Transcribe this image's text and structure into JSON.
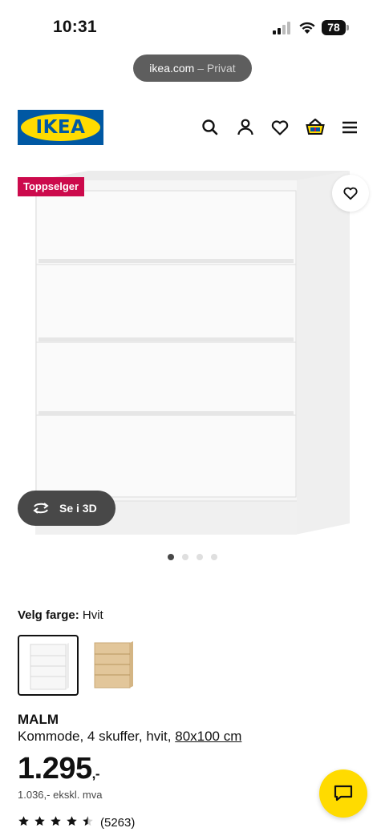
{
  "status_bar": {
    "time": "10:31",
    "battery": "78"
  },
  "browser": {
    "url": "ikea.com",
    "mode": "– Privat"
  },
  "header": {
    "logo_text": "IKEA",
    "brand_colors": {
      "blue": "#0058a3",
      "yellow": "#ffdb00"
    },
    "icons": [
      "search-icon",
      "account-icon",
      "favorites-icon",
      "cart-icon",
      "menu-icon"
    ]
  },
  "gallery": {
    "badge": "Toppselger",
    "badge_color": "#cc0a4c",
    "view_3d_label": "Se i 3D",
    "image_count": 4,
    "active_index": 0
  },
  "color_picker": {
    "label": "Velg farge:",
    "selected": "Hvit",
    "options": [
      "white",
      "oak-veneer"
    ]
  },
  "product": {
    "name": "MALM",
    "description": "Kommode, 4 skuffer, hvit,",
    "size": "80x100 cm",
    "price": "1.295",
    "price_suffix": ",-",
    "price_excl": "1.036,- ekskl. mva",
    "rating_stars": 4.5,
    "rating_count": "(5263)"
  }
}
